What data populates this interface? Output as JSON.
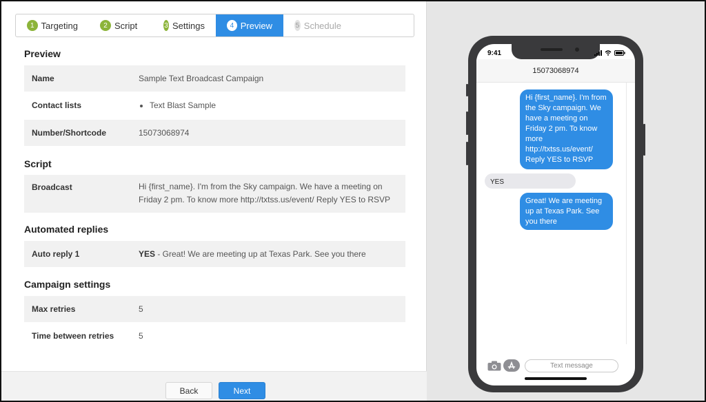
{
  "stepper": {
    "steps": [
      {
        "num": "1",
        "label": "Targeting"
      },
      {
        "num": "2",
        "label": "Script"
      },
      {
        "num": "3",
        "label": "Settings"
      },
      {
        "num": "4",
        "label": "Preview"
      },
      {
        "num": "5",
        "label": "Schedule"
      }
    ],
    "active_step": "Preview"
  },
  "preview": {
    "title": "Preview",
    "name_label": "Name",
    "name_value": "Sample Text Broadcast Campaign",
    "contact_lists_label": "Contact lists",
    "contact_lists": [
      "Text Blast Sample"
    ],
    "number_label": "Number/Shortcode",
    "number_value": "15073068974"
  },
  "script": {
    "title": "Script",
    "broadcast_label": "Broadcast",
    "broadcast_value": "Hi {first_name}. I'm from the Sky campaign. We have a meeting on Friday 2 pm. To know more http://txtss.us/event/ Reply YES to RSVP"
  },
  "auto_replies": {
    "title": "Automated replies",
    "reply1_label": "Auto reply 1",
    "reply1_keyword": "YES",
    "reply1_text": " - Great! We are meeting up at Texas Park. See you there"
  },
  "campaign_settings": {
    "title": "Campaign settings",
    "max_retries_label": "Max retries",
    "max_retries_value": "5",
    "time_between_label": "Time between retries",
    "time_between_value": "5"
  },
  "footer": {
    "back_label": "Back",
    "next_label": "Next"
  },
  "phone": {
    "time": "9:41",
    "contact": "15073068974",
    "messages": [
      {
        "dir": "out",
        "text": "Hi {first_name}. I'm from the Sky campaign. We have a meeting on Friday 2 pm. To know more http://txtss.us/event/ Reply YES to RSVP"
      },
      {
        "dir": "in",
        "text": "YES"
      },
      {
        "dir": "out",
        "text": "Great! We are meeting up at Texas Park. See you there"
      }
    ],
    "input_placeholder": "Text message",
    "icons": [
      "camera-icon",
      "app-store-icon",
      "signal-icon",
      "wifi-icon",
      "battery-icon"
    ]
  },
  "colors": {
    "accent": "#2f8de4",
    "step_done": "#8cb43a"
  }
}
